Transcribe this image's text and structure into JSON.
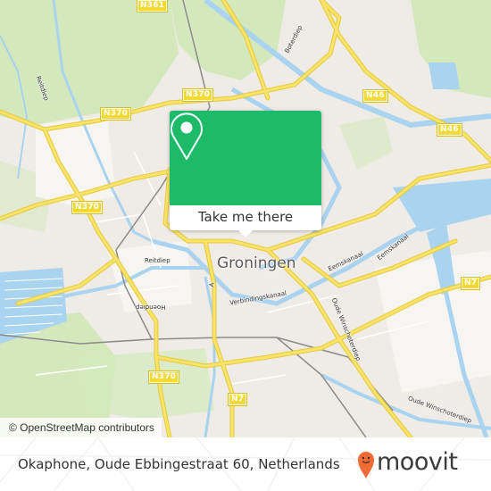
{
  "map": {
    "city_label": "Groningen",
    "road_shields": [
      "N361",
      "N370",
      "N370",
      "N370",
      "N370",
      "N46",
      "N46",
      "N7",
      "N7"
    ],
    "street_labels": [
      "Reitdiep",
      "Reitdiep",
      "Boterdiep",
      "Eemskanaal",
      "Eemskanaal",
      "Verbindingskanaal",
      "Oude Winschoterdiep",
      "Oude Winschoterdiep",
      "Hoendiep",
      "A"
    ],
    "colors": {
      "land": "#efebe6",
      "water": "#a9d3ef",
      "park": "#cfe8b5",
      "road_major": "#f5dd55",
      "shield": "#f2d935"
    }
  },
  "popup": {
    "icon": "map-pin-icon",
    "cta_label": "Take me there",
    "accent_color": "#1dba6a"
  },
  "attribution": "© OpenStreetMap contributors",
  "footer": {
    "address": "Okaphone, Oude Ebbingestraat 60, Netherlands",
    "brand": "moovit",
    "brand_icon": "moovit-pin-icon",
    "brand_color": "#f26a36"
  }
}
